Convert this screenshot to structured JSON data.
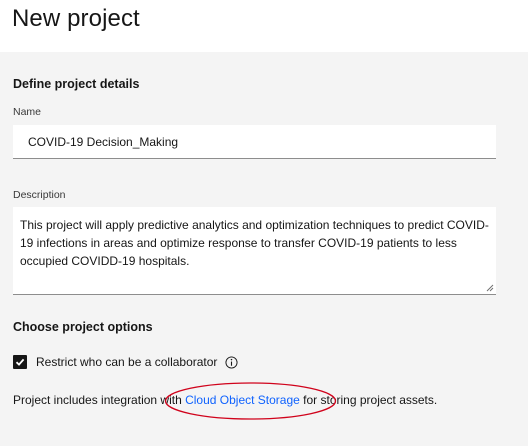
{
  "page": {
    "title": "New project"
  },
  "details": {
    "section_title": "Define project details",
    "name_label": "Name",
    "name_value": "COVID-19 Decision_Making",
    "description_label": "Description",
    "description_value": "This project will apply predictive analytics and optimization techniques to predict COVID-19 infections in areas and optimize response to transfer COVID-19 patients to less occupied COVIDD-19 hospitals."
  },
  "options": {
    "section_title": "Choose project options",
    "restrict_label": "Restrict who can be a collaborator",
    "restrict_checked": true,
    "integration_prefix": "Project includes integration with ",
    "integration_link": "Cloud Object Storage",
    "integration_suffix": " for storing project assets."
  },
  "colors": {
    "panel_bg": "#f4f4f4",
    "link": "#0f62fe",
    "annotation": "#d0021b"
  },
  "icons": {
    "checkbox": "checkmark-icon",
    "info": "info-icon",
    "resize": "resize-handle-icon"
  }
}
